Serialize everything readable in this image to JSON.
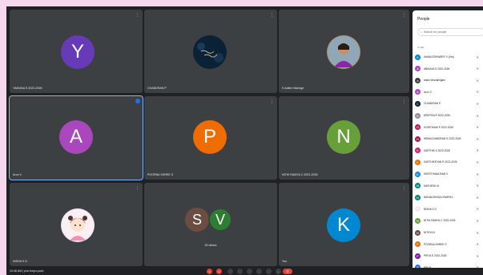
{
  "tiles": [
    {
      "name": "YAMUNA S 2022-2026",
      "initial": "Y",
      "color": "#673ab7"
    },
    {
      "name": "CHANDRAN P",
      "initial": "",
      "color": "#0b2236"
    },
    {
      "name": "S Aditee Maringe",
      "initial": "",
      "color": "#a07850"
    },
    {
      "name": "Arun V",
      "initial": "A",
      "color": "#ab47bc"
    },
    {
      "name": "POORNA SHREE S",
      "initial": "P",
      "color": "#ef6c00"
    },
    {
      "name": "NITHI RAMYA C 2022-2026",
      "initial": "N",
      "color": "#689f38"
    },
    {
      "name": "NISHA S G",
      "initial": "",
      "color": "#f3e5f5"
    },
    {
      "name": "25 others",
      "initial": "",
      "color": ""
    },
    {
      "name": "You",
      "initial": "K",
      "color": "#0288d1"
    }
  ],
  "others_avatars": [
    {
      "initial": "S",
      "color": "#6d4c41"
    },
    {
      "initial": "V",
      "color": "#2e7d32"
    }
  ],
  "panel": {
    "title": "People",
    "close": "×",
    "search_placeholder": "Search for people",
    "in_call": "In call",
    "people": [
      {
        "name": "KAMALESHWARY V (You)",
        "initial": "K",
        "color": "#0288d1"
      },
      {
        "name": "ABINAYA S 2022-2026",
        "initial": "A",
        "color": "#ab47bc"
      },
      {
        "name": "ahani dhanalingam",
        "initial": "a",
        "color": "#3c4043"
      },
      {
        "name": "Arun V",
        "initial": "A",
        "color": "#ab47bc"
      },
      {
        "name": "CHANDRAN P",
        "initial": "C",
        "color": "#0b2236"
      },
      {
        "name": "DEEPIKA R 2022-2026",
        "initial": "D",
        "color": "#8e8e8e"
      },
      {
        "name": "GOWTHAMI P 2022-2026",
        "initial": "G",
        "color": "#c2185b"
      },
      {
        "name": "HEMACHANDRAN S 2022-2026",
        "initial": "H",
        "color": "#ad1457"
      },
      {
        "name": "KARTHIK K 2022-2026",
        "initial": "K",
        "color": "#d81b60"
      },
      {
        "name": "KARTHIKEYAN R 2022-2026",
        "initial": "K",
        "color": "#ef6c00"
      },
      {
        "name": "KEERTHANA RAM V",
        "initial": "K",
        "color": "#1e88e5"
      },
      {
        "name": "MATHESH M",
        "initial": "M",
        "color": "#00897b"
      },
      {
        "name": "NANDA DHISA DHARSH...",
        "initial": "N",
        "color": "#00897b"
      },
      {
        "name": "NISHA S G",
        "initial": "N",
        "color": "#f3e5f5"
      },
      {
        "name": "NITHI RAMYA C 2022-2026",
        "initial": "N",
        "color": "#689f38"
      },
      {
        "name": "NITHYA K",
        "initial": "N",
        "color": "#6d4c41"
      },
      {
        "name": "POORNA SHREE S",
        "initial": "P",
        "color": "#ef6c00"
      },
      {
        "name": "PRIYA S 2022-2026",
        "initial": "P",
        "color": "#7b1fa2"
      },
      {
        "name": "PRIYA",
        "initial": "P",
        "color": "#1a73e8"
      }
    ]
  },
  "bottom": {
    "time_meeting": "10:46 AM  |  pxe-hwpu-puez"
  },
  "icons": {
    "menu": "⋮",
    "mic_off": "✕",
    "search": "⌕",
    "more": "⋮",
    "end": "✆"
  }
}
